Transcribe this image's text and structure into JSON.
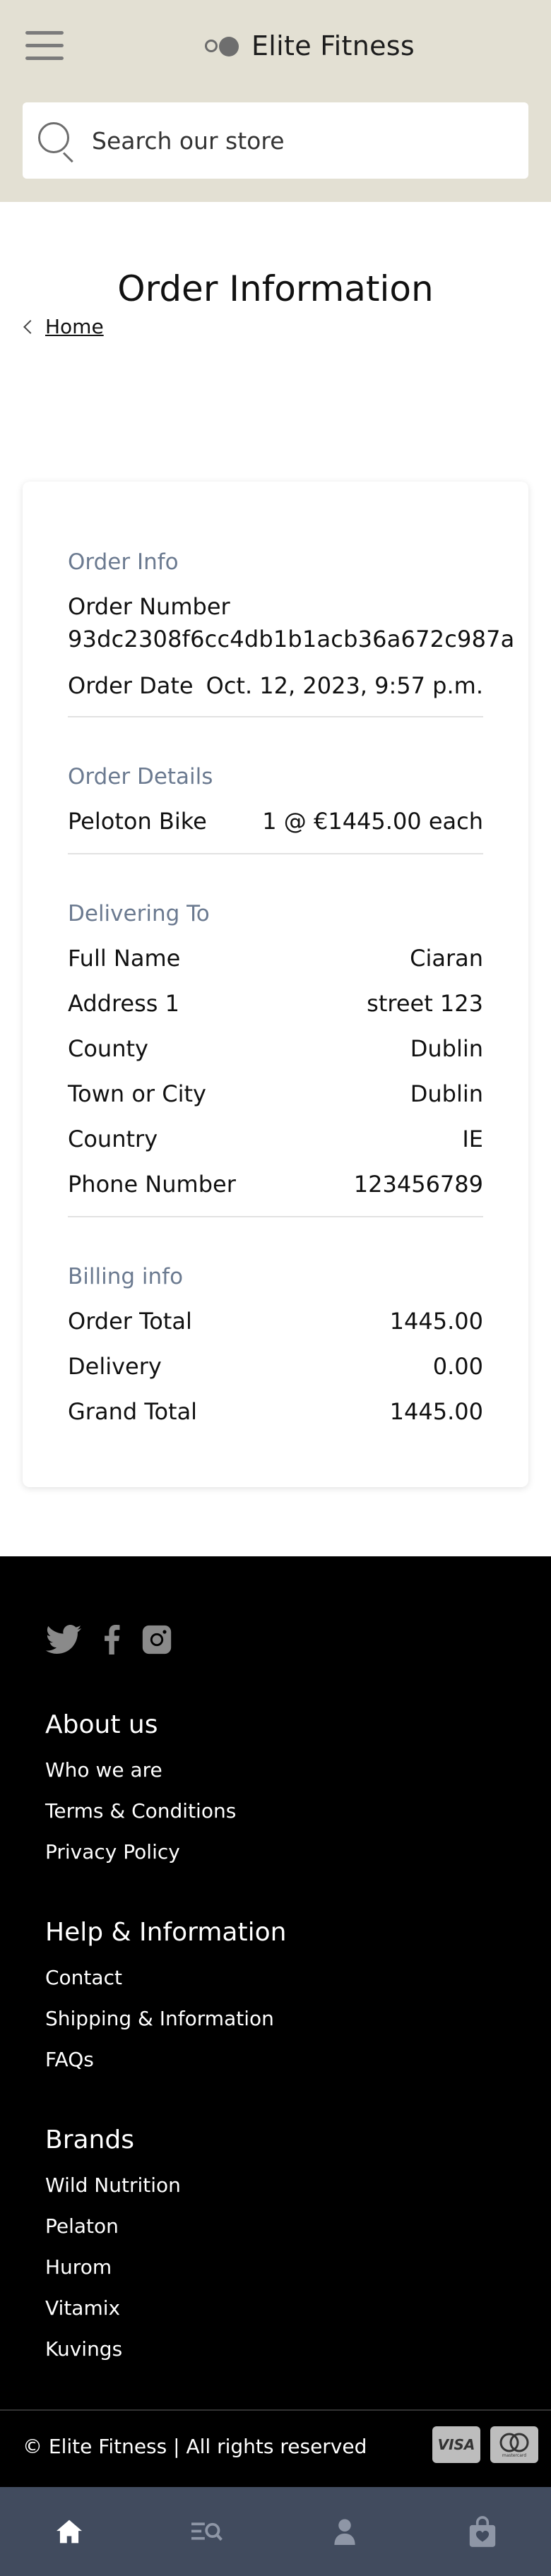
{
  "header": {
    "brand": "Elite Fitness",
    "search_placeholder": "Search our store"
  },
  "page": {
    "title": "Order Information",
    "breadcrumb_home": "Home"
  },
  "order_info": {
    "section": "Order Info",
    "number_label": "Order Number",
    "number_value": "93dc2308f6cc4db1b1acb36a672c987a",
    "date_label": "Order Date",
    "date_value": "Oct. 12, 2023, 9:57 p.m."
  },
  "order_details": {
    "section": "Order Details",
    "items": [
      {
        "name": "Peloton Bike",
        "qty_price": "1 @ €1445.00 each"
      }
    ]
  },
  "delivering_to": {
    "section": "Delivering To",
    "rows": [
      {
        "label": "Full Name",
        "value": "Ciaran"
      },
      {
        "label": "Address 1",
        "value": "street 123"
      },
      {
        "label": "County",
        "value": "Dublin"
      },
      {
        "label": "Town or City",
        "value": "Dublin"
      },
      {
        "label": "Country",
        "value": "IE"
      },
      {
        "label": "Phone Number",
        "value": "123456789"
      }
    ]
  },
  "billing": {
    "section": "Billing info",
    "rows": [
      {
        "label": "Order Total",
        "value": "1445.00"
      },
      {
        "label": "Delivery",
        "value": "0.00"
      },
      {
        "label": "Grand Total",
        "value": "1445.00"
      }
    ]
  },
  "footer": {
    "social_icons": [
      "twitter-icon",
      "facebook-icon",
      "instagram-icon"
    ],
    "about": {
      "title": "About us",
      "links": [
        "Who we are",
        "Terms & Conditions",
        "Privacy Policy"
      ]
    },
    "help": {
      "title": "Help & Information",
      "links": [
        "Contact",
        "Shipping & Information",
        "FAQs"
      ]
    },
    "brands": {
      "title": "Brands",
      "links": [
        "Wild Nutrition",
        "Pelaton",
        "Hurom",
        "Vitamix",
        "Kuvings"
      ]
    },
    "copyright": "© Elite Fitness | All rights reserved",
    "payment_cards": [
      "VISA",
      "mastercard"
    ]
  },
  "bottom_nav": [
    "home-icon",
    "search-list-icon",
    "account-icon",
    "bag-icon"
  ],
  "colors": {
    "header_bg": "#e3e0d3",
    "section_title": "#6b7a90",
    "footer_bg": "#000000",
    "bottom_nav_bg": "#414b5e"
  }
}
